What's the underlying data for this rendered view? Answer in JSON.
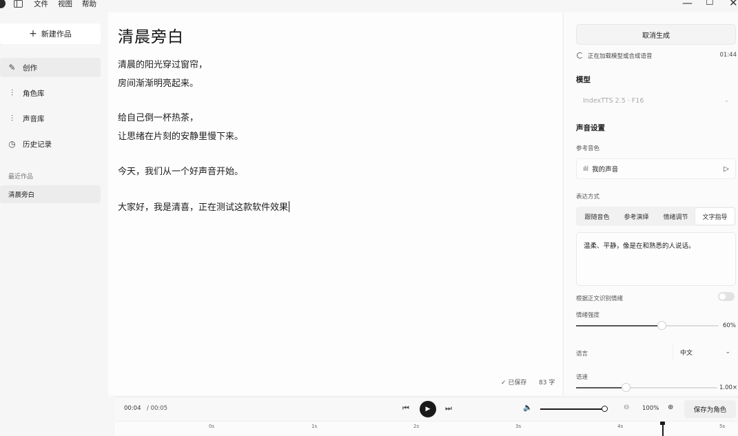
{
  "menubar": {
    "items": [
      "文件",
      "视图",
      "帮助"
    ],
    "window_controls": {
      "minimize": "—",
      "maximize": "☐",
      "close": "✕"
    }
  },
  "sidebar": {
    "new_button": "新建作品",
    "nav": [
      {
        "label": "创作",
        "icon": "pencil-icon",
        "active": true
      },
      {
        "label": "角色库",
        "icon": "waveform-icon",
        "active": false
      },
      {
        "label": "声音库",
        "icon": "waveform-icon",
        "active": false
      },
      {
        "label": "历史记录",
        "icon": "clock-icon",
        "active": false
      }
    ],
    "recent_title": "最近作品",
    "recent_items": [
      "清晨旁白"
    ]
  },
  "editor": {
    "title": "清晨旁白",
    "paragraphs": [
      [
        "清晨的阳光穿过窗帘，",
        "房间渐渐明亮起来。"
      ],
      [
        "给自己倒一杯热茶，",
        "让思绪在片刻的安静里慢下来。"
      ],
      [
        "今天，我们从一个好声音开始。"
      ],
      [
        "大家好，我是清喜，正在测试这款软件效果"
      ]
    ],
    "saved_status": "已保存",
    "word_count": "83 字"
  },
  "right_panel": {
    "cancel_button": "取消生成",
    "loading_text": "正在加载模型或合成语音",
    "loading_time": "01:44",
    "model_title": "模型",
    "model_value": "IndexTTS 2.5 · F16",
    "voice_settings_title": "声音设置",
    "ref_voice_label": "参考音色",
    "ref_voice_value": "我的声音",
    "expression_label": "表达方式",
    "tabs": [
      "跟随音色",
      "参考演绎",
      "情绪调节",
      "文字指导"
    ],
    "active_tab": 3,
    "text_guide": "温柔、平静，像是在和熟悉的人说话。",
    "auto_emotion_label": "根据正文识别情绪",
    "auto_emotion_enabled": false,
    "intensity_label": "情绪强度",
    "intensity_value": "60%",
    "intensity_fraction": 0.6,
    "language_label": "语言",
    "language_value": "中文",
    "speed_label": "语速",
    "speed_value": "1.00×",
    "speed_fraction": 0.35
  },
  "player": {
    "current_time": "00:04",
    "total_time": "/ 00:05",
    "volume_fraction": 1.0,
    "zoom": "100%",
    "save_role_button": "保存为角色",
    "timeline_ticks": [
      "0s",
      "1s",
      "2s",
      "3s",
      "4s",
      "5s"
    ],
    "playhead_time_s": 4.4
  },
  "colors": {
    "accent": "#1a1a1a",
    "background": "#f6f6f6",
    "editor_bg": "#fdfdfd"
  }
}
